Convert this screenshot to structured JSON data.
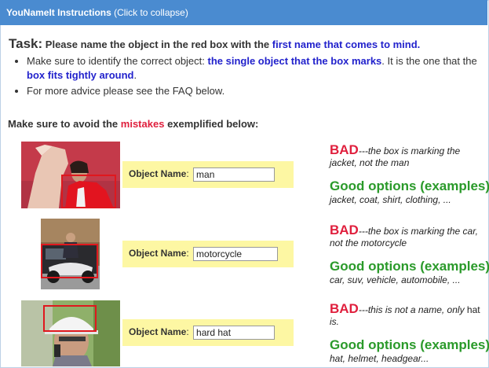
{
  "header": {
    "title": "YouNameIt Instructions",
    "hint": "(Click to collapse)"
  },
  "task": {
    "label": "Task:",
    "text_before": "Please name the object in the red box with the",
    "highlight": "first name that comes to mind."
  },
  "bullets": {
    "b1_before": "Make sure to identify the correct object:",
    "b1_highlight1": "the single object that the box marks",
    "b1_middle": ". It is the one that the",
    "b1_highlight2": "box fits tightly around",
    "b1_end": ".",
    "b2": "For more advice please see the FAQ below."
  },
  "avoid": {
    "before": "Make sure to avoid the",
    "highlight": "mistakes",
    "after": "exemplified below:"
  },
  "field_label": "Object Name",
  "colors": {
    "header_bg": "#4a8bd0",
    "field_bg": "#fdf7a3",
    "bad_red": "#e01f3d",
    "good_green": "#2a9a2a",
    "link_blue": "#2222cc",
    "bounding_box_red": "#e0181e"
  },
  "examples": [
    {
      "object_name": "man",
      "bad_label": "BAD",
      "bad_text": "---the box is marking the jacket, not the man",
      "good_title": "Good options (examples):",
      "good_list": "jacket, coat, shirt, clothing, ..."
    },
    {
      "object_name": "motorcycle",
      "bad_label": "BAD",
      "bad_text": "---the box is marking the car, not the motorcycle",
      "good_title": "Good options (examples):",
      "good_list": "car, suv, vehicle, automobile, ..."
    },
    {
      "object_name": "hard hat",
      "bad_label": "BAD",
      "bad_text": "---this is not a name, only",
      "bad_plain": "hat",
      "bad_end": "is.",
      "good_title": "Good options (examples):",
      "good_list": "hat, helmet, headgear..."
    }
  ]
}
